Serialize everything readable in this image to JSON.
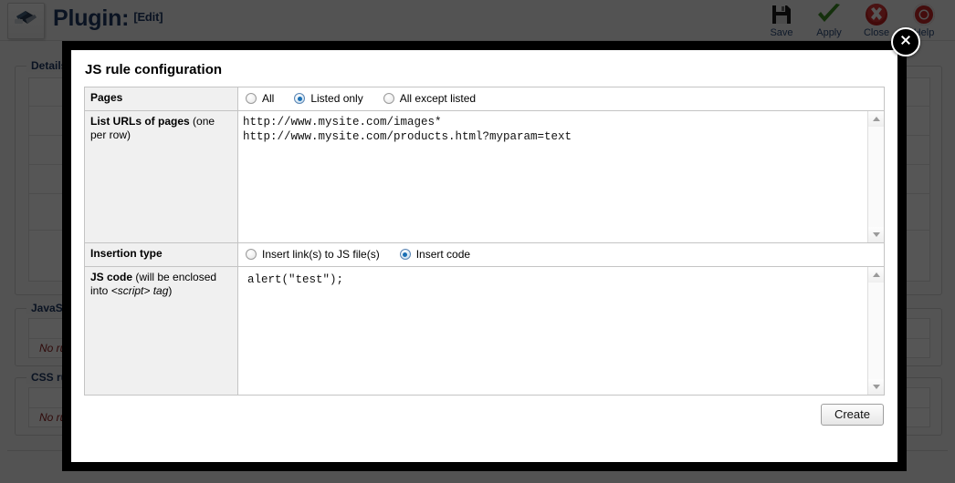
{
  "header": {
    "plugin_icon": "usb-plug-icon",
    "title": "Plugin:",
    "edit_link": "[Edit]",
    "toolbar": [
      {
        "id": "save",
        "label": "Save",
        "icon": "floppy-disk-icon"
      },
      {
        "id": "apply",
        "label": "Apply",
        "icon": "green-check-icon"
      },
      {
        "id": "close",
        "label": "Close",
        "icon": "red-x-circle-icon"
      },
      {
        "id": "help",
        "label": "Help",
        "icon": "lifering-icon"
      }
    ]
  },
  "background": {
    "sections": [
      {
        "legend": "Details",
        "no_rules": null
      },
      {
        "legend": "JavaScript rules",
        "no_rules": "No rules"
      },
      {
        "legend": "CSS rules",
        "no_rules": "No rules"
      }
    ]
  },
  "modal": {
    "title": "JS rule configuration",
    "close_icon": "close-x-icon",
    "pages": {
      "label": "Pages",
      "options": [
        {
          "id": "all",
          "label": "All",
          "checked": false
        },
        {
          "id": "listed-only",
          "label": "Listed only",
          "checked": true
        },
        {
          "id": "all-except-listed",
          "label": "All except listed",
          "checked": false
        }
      ]
    },
    "urls": {
      "label_bold": "List URLs of pages",
      "label_normal": " (one per row)",
      "value": "http://www.mysite.com/images*\nhttp://www.mysite.com/products.html?myparam=text",
      "placeholder": ""
    },
    "insertion_type": {
      "label": "Insertion type",
      "options": [
        {
          "id": "insert-link",
          "label": "Insert link(s) to JS file(s)",
          "checked": false
        },
        {
          "id": "insert-code",
          "label": "Insert code",
          "checked": true
        }
      ]
    },
    "js_code": {
      "label_bold": "JS code",
      "label_normal_1": " (will be enclosed into ",
      "label_italic": "<script>",
      "label_italic_2": " tag",
      "label_normal_2": ")",
      "value": "alert(\"test\");",
      "placeholder": ""
    },
    "create_button": "Create"
  },
  "colors": {
    "title_blue": "#1f3864",
    "accent_radio": "#1a6fb5",
    "no_rules_red": "#8b1a1a",
    "modal_border": "#000000"
  }
}
